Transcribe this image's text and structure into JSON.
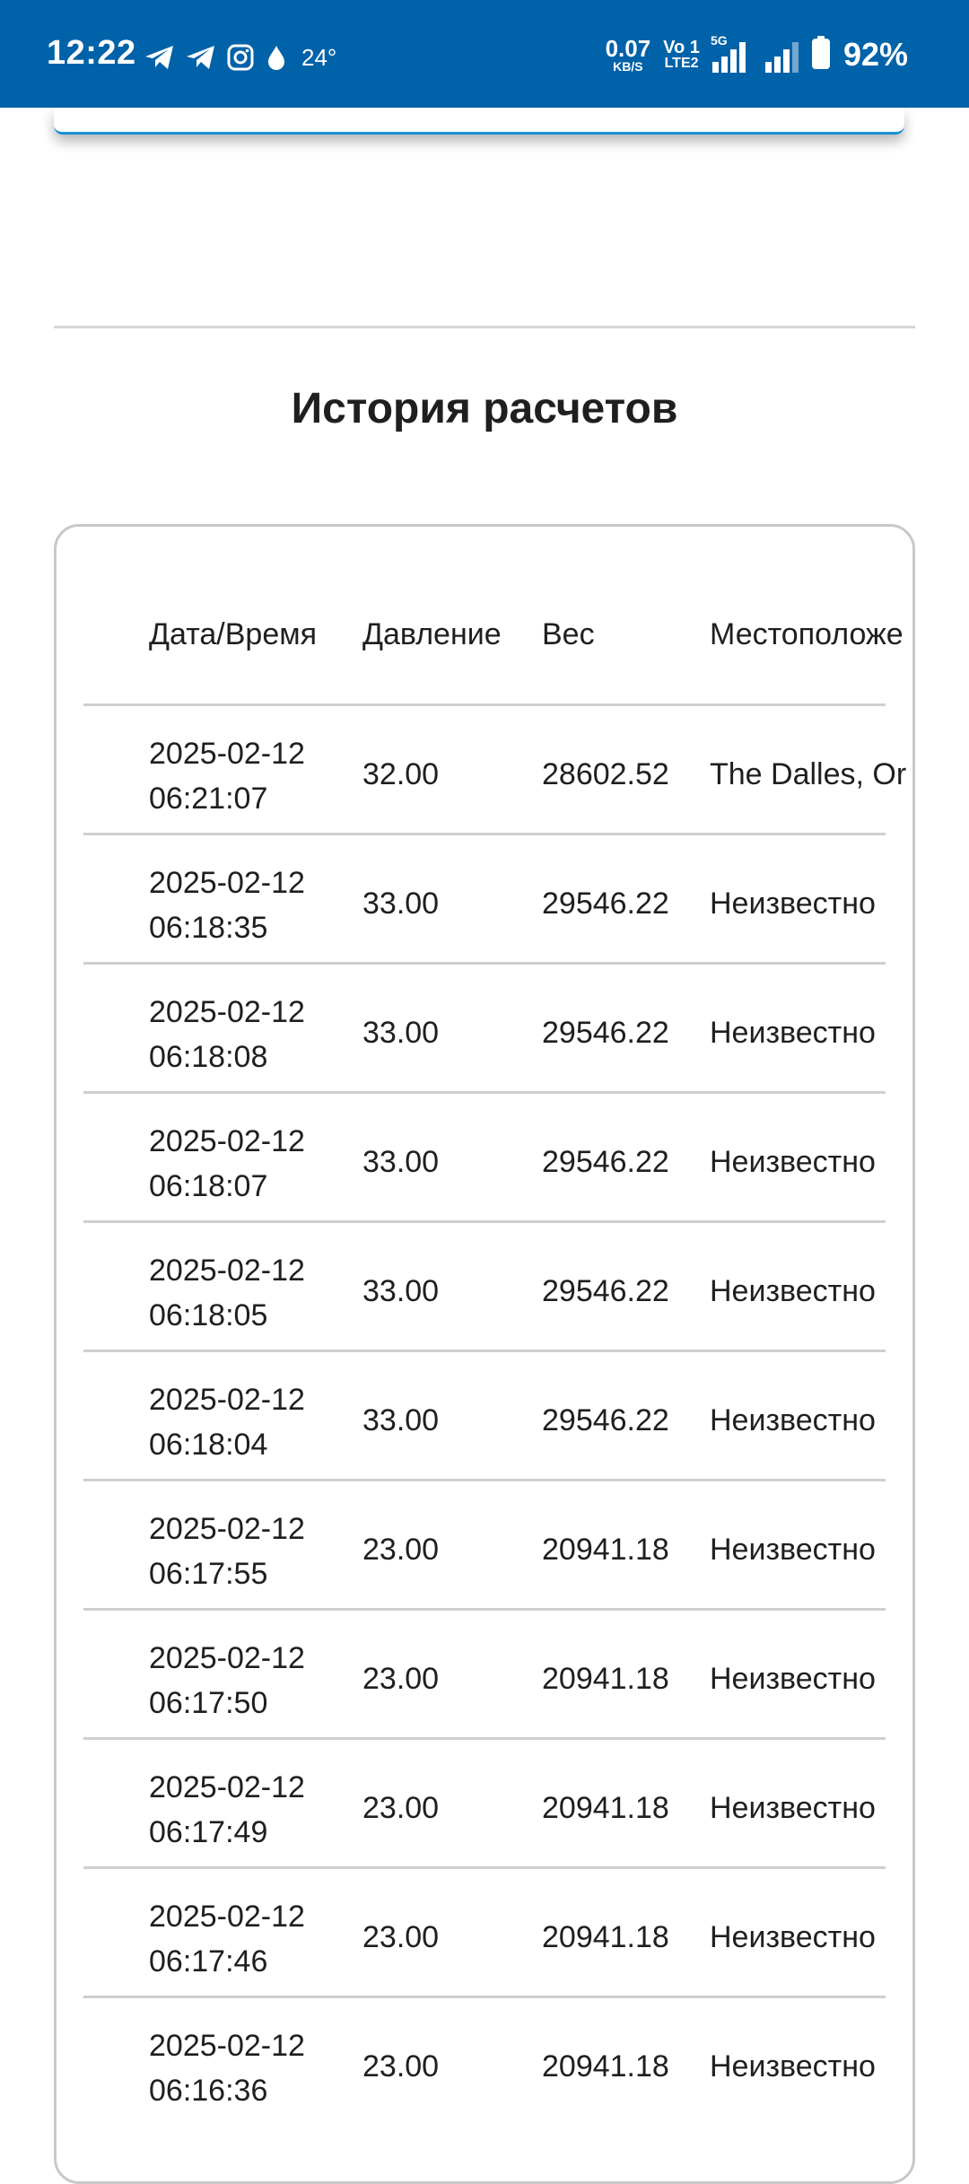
{
  "status_bar": {
    "time": "12:22",
    "temperature": "24°",
    "net_speed_value": "0.07",
    "net_speed_unit": "KB/S",
    "volte_top": "Vo 1",
    "volte_bottom": "LTE2",
    "signal_label": "5G",
    "battery": "92%"
  },
  "history": {
    "title": "История расчетов",
    "columns": {
      "datetime": "Дата/Время",
      "pressure": "Давление",
      "weight": "Вес",
      "location": "Местоположе"
    },
    "rows": [
      {
        "date": "2025-02-12",
        "time": "06:21:07",
        "pressure": "32.00",
        "weight": "28602.52",
        "location": "The Dalles, Or"
      },
      {
        "date": "2025-02-12",
        "time": "06:18:35",
        "pressure": "33.00",
        "weight": "29546.22",
        "location": "Неизвестно"
      },
      {
        "date": "2025-02-12",
        "time": "06:18:08",
        "pressure": "33.00",
        "weight": "29546.22",
        "location": "Неизвестно"
      },
      {
        "date": "2025-02-12",
        "time": "06:18:07",
        "pressure": "33.00",
        "weight": "29546.22",
        "location": "Неизвестно"
      },
      {
        "date": "2025-02-12",
        "time": "06:18:05",
        "pressure": "33.00",
        "weight": "29546.22",
        "location": "Неизвестно"
      },
      {
        "date": "2025-02-12",
        "time": "06:18:04",
        "pressure": "33.00",
        "weight": "29546.22",
        "location": "Неизвестно"
      },
      {
        "date": "2025-02-12",
        "time": "06:17:55",
        "pressure": "23.00",
        "weight": "20941.18",
        "location": "Неизвестно"
      },
      {
        "date": "2025-02-12",
        "time": "06:17:50",
        "pressure": "23.00",
        "weight": "20941.18",
        "location": "Неизвестно"
      },
      {
        "date": "2025-02-12",
        "time": "06:17:49",
        "pressure": "23.00",
        "weight": "20941.18",
        "location": "Неизвестно"
      },
      {
        "date": "2025-02-12",
        "time": "06:17:46",
        "pressure": "23.00",
        "weight": "20941.18",
        "location": "Неизвестно"
      },
      {
        "date": "2025-02-12",
        "time": "06:16:36",
        "pressure": "23.00",
        "weight": "20941.18",
        "location": "Неизвестно"
      }
    ]
  },
  "icons": [
    "telegram-icon",
    "telegram-icon",
    "instagram-icon",
    "drop-icon",
    "signal-icon",
    "battery-icon"
  ],
  "colors": {
    "status_bar": "#0062a8",
    "accent": "#1a8fd6"
  }
}
